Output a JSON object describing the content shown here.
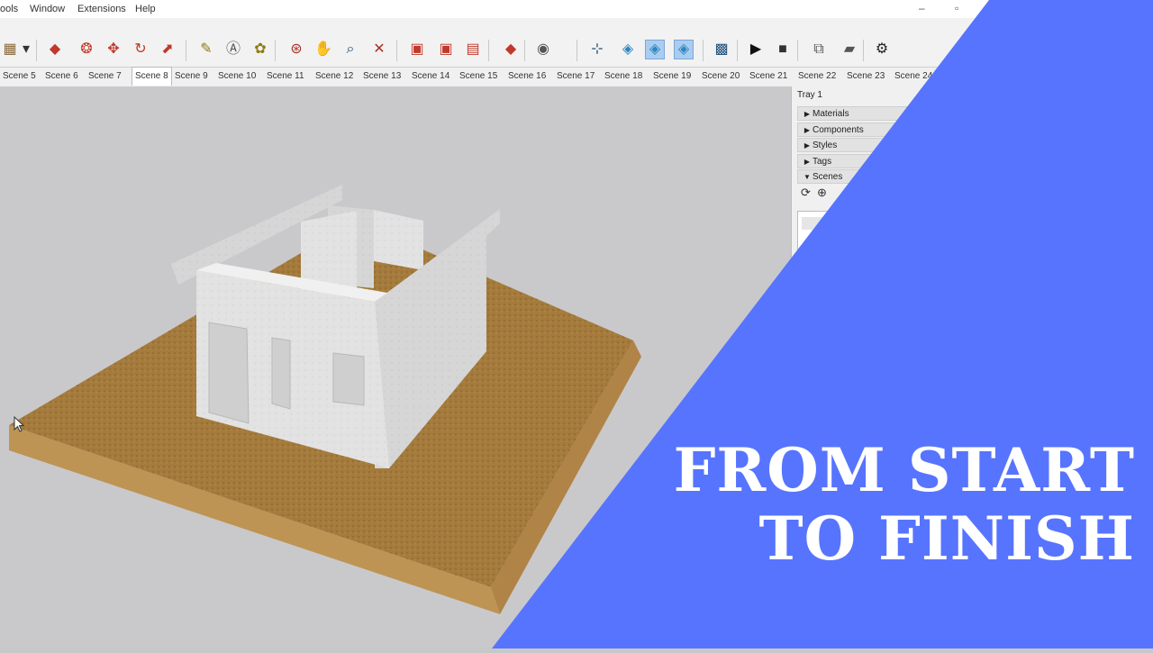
{
  "menu": {
    "items": [
      "ools",
      "Window",
      "Extensions",
      "Help"
    ],
    "minimize": "–",
    "restore": "▫"
  },
  "scenes": {
    "tabs": [
      "Scene 5",
      "Scene 6",
      "Scene 7",
      "Scene 8",
      "Scene 9",
      "Scene 10",
      "Scene 11",
      "Scene 12",
      "Scene 13",
      "Scene 14",
      "Scene 15",
      "Scene 16",
      "Scene 17",
      "Scene 18",
      "Scene 19",
      "Scene 20",
      "Scene 21",
      "Scene 22",
      "Scene 23",
      "Scene 24"
    ],
    "active": "Scene 8"
  },
  "tray": {
    "title": "Tray 1",
    "panels": [
      {
        "label": "Materials",
        "state": "collapsed"
      },
      {
        "label": "Components",
        "state": "collapsed"
      },
      {
        "label": "Styles",
        "state": "collapsed"
      },
      {
        "label": "Tags",
        "state": "collapsed"
      },
      {
        "label": "Scenes",
        "state": "expanded"
      }
    ]
  },
  "toolbar": {
    "icons": [
      "box-select-icon",
      "dropdown-arrow-icon",
      "paint-bucket-icon",
      "offset-icon",
      "move-icon",
      "rotate-icon",
      "scale-icon",
      "tape-measure-icon",
      "text-icon",
      "paint-icon",
      "orbit-icon",
      "pan-icon",
      "zoom-icon",
      "zoom-extents-icon",
      "warehouse-icon",
      "extension-warehouse-icon",
      "layout-icon",
      "ruby-icon",
      "profile-icon",
      "section-plane-icon",
      "cube-icon",
      "cube-active-icon",
      "cube-active-2-icon",
      "sandbox-icon",
      "play-icon",
      "stop-icon",
      "camera-icon",
      "video-icon",
      "gear-icon"
    ]
  },
  "banner": {
    "line1": "FROM START",
    "line2": "TO FINISH",
    "color": "#5774ff",
    "text_color": "#ffffff"
  },
  "colors": {
    "ground_top": "#a47b3c",
    "ground_side": "#b98f4e",
    "walls": "#e4e4e4",
    "viewport_bg": "#c9c9cc"
  }
}
